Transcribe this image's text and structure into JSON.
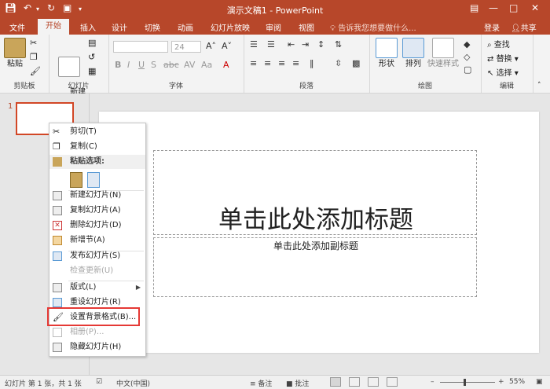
{
  "titlebar": {
    "title": "演示文稿1 - PowerPoint"
  },
  "tabs": [
    "文件",
    "开始",
    "插入",
    "设计",
    "切换",
    "动画",
    "幻灯片放映",
    "审阅",
    "视图"
  ],
  "tellme": "告诉我您想要做什么...",
  "account": {
    "login": "登录",
    "share": "共享"
  },
  "ribbon": {
    "clipboard": {
      "paste": "粘贴",
      "label": "剪贴板"
    },
    "slides": {
      "new_slide": "新建\n幻灯片",
      "label": "幻灯片"
    },
    "font": {
      "font_size": "24",
      "label": "字体"
    },
    "paragraph": {
      "label": "段落"
    },
    "drawing": {
      "shapes": "形状",
      "arrange": "排列",
      "quick_styles": "快速样式",
      "label": "绘图"
    },
    "editing": {
      "find": "查找",
      "replace": "替换",
      "select": "选择",
      "label": "编辑"
    }
  },
  "thumbnails": {
    "slide_number": "1"
  },
  "slide": {
    "title_placeholder": "单击此处添加标题",
    "subtitle_placeholder": "单击此处添加副标题"
  },
  "context_menu": {
    "cut": "剪切(T)",
    "copy": "复制(C)",
    "paste_options": "粘贴选项:",
    "new_slide": "新建幻灯片(N)",
    "duplicate_slide": "复制幻灯片(A)",
    "delete_slide": "删除幻灯片(D)",
    "add_section": "新增节(A)",
    "publish_slides": "发布幻灯片(S)",
    "check_updates": "检查更新(U)",
    "layout": "版式(L)",
    "reset_slide": "重设幻灯片(R)",
    "format_background": "设置背景格式(B)...",
    "photo_album": "相册(P)...",
    "hide_slide": "隐藏幻灯片(H)"
  },
  "statusbar": {
    "slide_info": "幻灯片 第 1 张，共 1 张",
    "language": "中文(中国)",
    "notes": "备注",
    "comments": "批注",
    "zoom": "55%"
  },
  "colors": {
    "accent": "#b7472a",
    "highlight_box": "#e53935"
  }
}
